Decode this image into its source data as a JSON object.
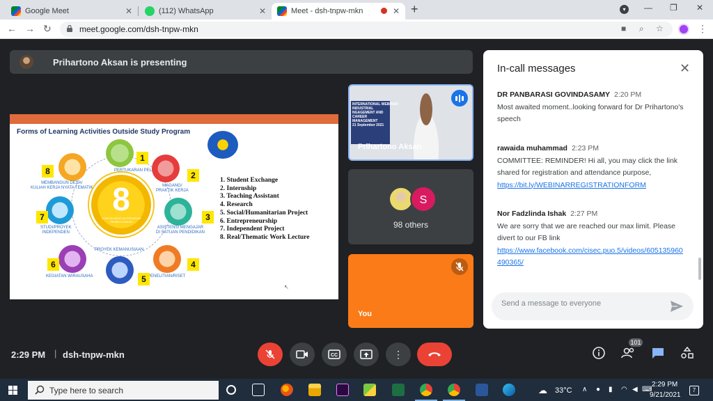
{
  "browser": {
    "tabs": [
      {
        "title": "Google Meet",
        "close": "✕"
      },
      {
        "title": "(112) WhatsApp",
        "close": "✕"
      },
      {
        "title": "Meet - dsh-tnpw-mkn",
        "close": "✕"
      }
    ],
    "new_tab": "+",
    "url": "meet.google.com/dsh-tnpw-mkn"
  },
  "meet": {
    "presenting_banner": "Prihartono Aksan is presenting",
    "slide": {
      "title": "Forms of Learning Activities Outside Study Program",
      "center_number": "8",
      "center_caption": "CONTOH BENTUK PROGRAM PEMBELAJARAN",
      "activities": [
        {
          "num": "1",
          "label": "PERTUKARAN PELAJAR"
        },
        {
          "num": "2",
          "label": "MAGANG/\nPRAKTIK KERJA"
        },
        {
          "num": "3",
          "label": "ASISTENSI MENGAJAR\nDI SATUAN PENDIDIKAN"
        },
        {
          "num": "4",
          "label": "PENELITIAN/RISET"
        },
        {
          "num": "5",
          "label": "PROYEK KEMANUSIAAN"
        },
        {
          "num": "6",
          "label": "KEGIATAN WIRAUSAHA"
        },
        {
          "num": "7",
          "label": "STUDI/PROYEK\nINDEPENDEN"
        },
        {
          "num": "8",
          "label": "MEMBANGUN DESA/\nKULIAH KERJA NYATA TEMATIK"
        }
      ],
      "list": [
        "1. Student Exchange",
        "2. Internship",
        "3. Teaching Assistant",
        "4. Research",
        "5. Social/Humanitarian Project",
        "6. Entrepreneurship",
        "7. Independent Project",
        "8. Real/Thematic Work Lecture"
      ]
    },
    "presenter_tile": {
      "name": "Prihartono Aksan",
      "banner_text": "INTERNATIONAL WEBINAR\nINDUSTRIAL\nNGAGEMENT AND\nCAREER\nMANAGEMENT\n21 September 2021"
    },
    "others_tile": {
      "initial": "S",
      "label": "98 others"
    },
    "you_tile": {
      "label": "You"
    },
    "chat": {
      "title": "In-call messages",
      "messages": [
        {
          "sender": "DR PANBARASI GOVINDASAMY",
          "time": "2:20 PM",
          "text": "Most awaited moment..looking forward for Dr Prihartono's speech",
          "link": ""
        },
        {
          "sender": "rawaida muhammad",
          "time": "2:23 PM",
          "text": "COMMITTEE: REMINDER! Hi all, you may click the link shared for registration and attendance purpose,",
          "link": "https://bit.ly/WEBINARREGISTRATIONFORM"
        },
        {
          "sender": "Nor Fadzlinda Ishak",
          "time": "2:27 PM",
          "text": "We are sorry that we are reached our max limit. Please divert to our FB link",
          "link": "https://www.facebook.com/cisec.puo.5/videos/605135960490365/"
        }
      ],
      "input_placeholder": "Send a message to everyone"
    },
    "bottom": {
      "time": "2:29 PM",
      "divider": "|",
      "meeting_code": "dsh-tnpw-mkn",
      "people_count": "101"
    }
  },
  "taskbar": {
    "search_placeholder": "Type here to search",
    "temperature": "33°C",
    "time": "2:29 PM",
    "date": "9/21/2021",
    "notification_count": "7"
  },
  "colors": {
    "meet_bg": "#202124",
    "tile_you": "#fa7b17",
    "hangup": "#ea4335",
    "accent": "#1a73e8"
  }
}
